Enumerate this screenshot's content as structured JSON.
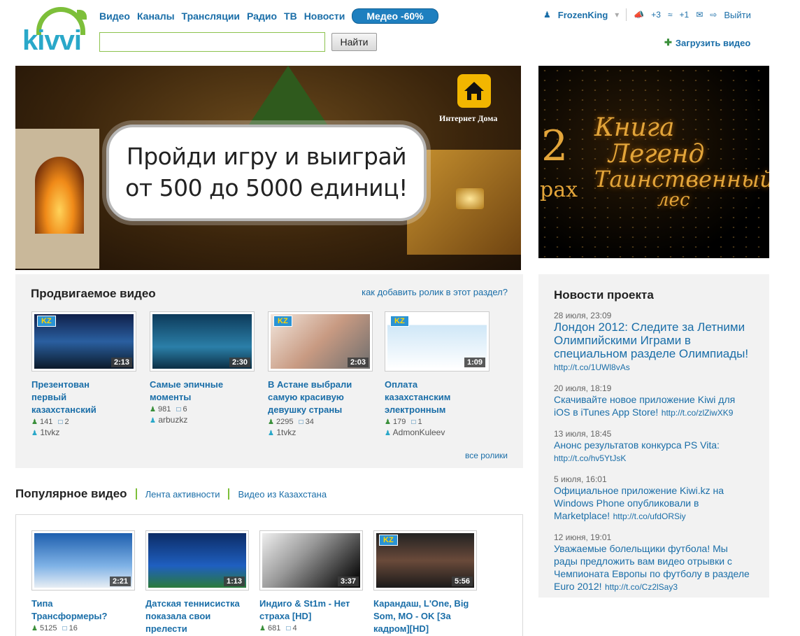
{
  "header": {
    "logo_text": "kivvi",
    "nav": [
      "Видео",
      "Каналы",
      "Трансляции",
      "Радио",
      "ТВ",
      "Новости"
    ],
    "promo_label": "Медео -60%",
    "search_button": "Найти",
    "search_value": "",
    "username": "FrozenKing",
    "notif_1": "+3",
    "notif_2": "+1",
    "logout": "Выйти",
    "upload": "Загрузить видео"
  },
  "banner": {
    "line1": "Пройди игру и выиграй",
    "line2": "от 500 до 5000 единиц!",
    "badge": "Интернет Дома"
  },
  "side_banner": {
    "number": "2",
    "title_1": "Книга",
    "title_2": "Легенд",
    "title_3": "Таинственный",
    "title_4": "лес",
    "partial": "рах"
  },
  "promoted": {
    "title": "Продвигаемое видео",
    "howto": "как добавить ролик в этот раздел?",
    "all": "все ролики",
    "videos": [
      {
        "title": "Презентован первый казахстанский",
        "duration": "2:13",
        "views": "141",
        "comments": "2",
        "author": "1tvkz",
        "kz": "KZ"
      },
      {
        "title": "Самые эпичные моменты",
        "duration": "2:30",
        "views": "981",
        "comments": "6",
        "author": "arbuzkz",
        "kz": ""
      },
      {
        "title": "В Астане выбрали самую красивую девушку страны",
        "duration": "2:03",
        "views": "2295",
        "comments": "34",
        "author": "1tvkz",
        "kz": "KZ"
      },
      {
        "title": "Оплата казахстанским электронным",
        "duration": "1:09",
        "views": "179",
        "comments": "1",
        "author": "AdmonKuleev",
        "kz": "KZ"
      }
    ]
  },
  "popular": {
    "title": "Популярное видео",
    "tab1": "Лента активности",
    "tab2": "Видео из Казахстана",
    "videos": [
      {
        "title": "Типа Трансформеры?",
        "duration": "2:21",
        "views": "5125",
        "comments": "16",
        "kz": ""
      },
      {
        "title": "Датская теннисистка показала свои прелести",
        "duration": "1:13",
        "views": "",
        "comments": "",
        "kz": ""
      },
      {
        "title": "Индиго & St1m - Нет страха [HD]",
        "duration": "3:37",
        "views": "681",
        "comments": "4",
        "kz": ""
      },
      {
        "title": "Карандаш, L'One, Big Som, MO - OK [За кадром][HD]",
        "duration": "5:56",
        "views": "",
        "comments": "",
        "kz": "KZ"
      }
    ]
  },
  "news": {
    "title": "Новости проекта",
    "items": [
      {
        "date": "28 июля, 23:09",
        "text": "Лондон 2012: Следите за Летними Олимпийскими Играми в специальном разделе Олимпиады!",
        "link": "http://t.co/1UWl8vAs"
      },
      {
        "date": "20 июля, 18:19",
        "text": "Скачивайте новое приложение Kiwi для iOS в iTunes App Store!",
        "link": "http://t.co/zlZiwXK9"
      },
      {
        "date": "13 июля, 18:45",
        "text": "Анонс результатов конкурса PS Vita:",
        "link": "http://t.co/hv5YtJsK"
      },
      {
        "date": "5 июля, 16:01",
        "text": "Официальное приложение Kiwi.kz на Windows Phone опубликовали в Marketplace!",
        "link": "http://t.co/ufdORSiy"
      },
      {
        "date": "12 июня, 19:01",
        "text": "Уважаемые болельщики футбола! Мы рады предложить вам видео отрывки с Чемпионата Европы по футболу в разделе Euro 2012!",
        "link": "http://t.co/Cz2lSay3"
      }
    ]
  },
  "colors": {
    "link": "#1a6ea8",
    "accent_green": "#7dbf3a",
    "logo_blue": "#2aa8c9"
  }
}
